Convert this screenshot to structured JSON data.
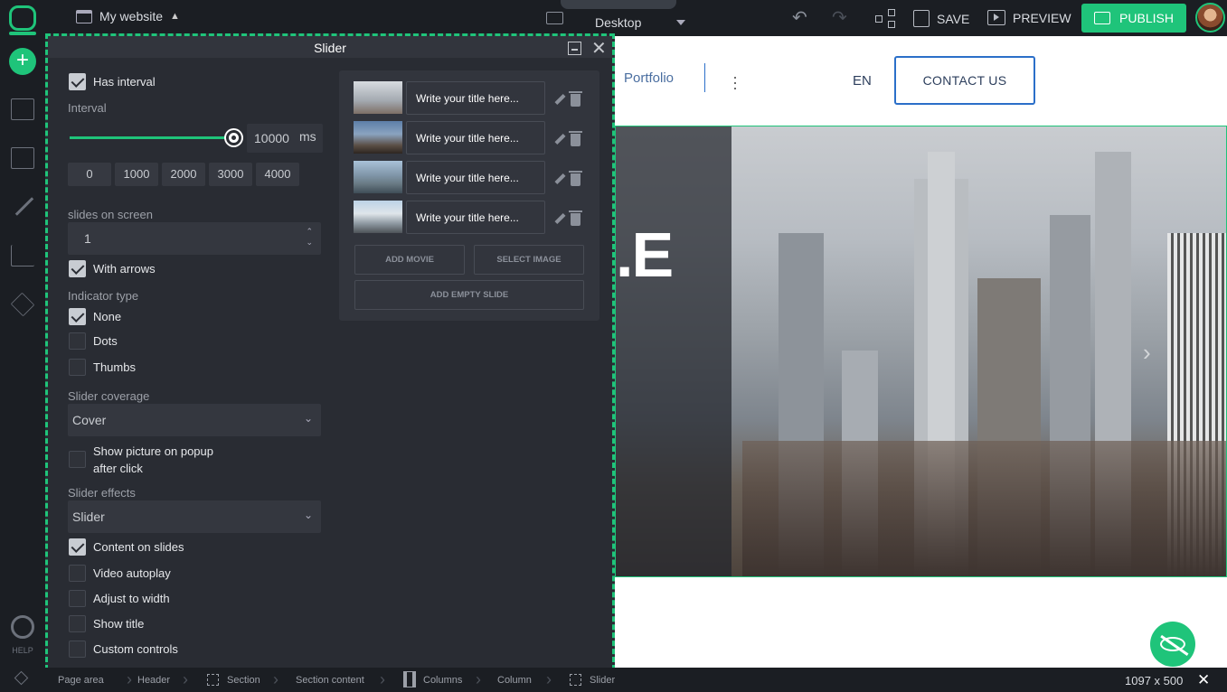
{
  "topbar": {
    "site_title": "My website",
    "device": "Desktop",
    "save_label": "SAVE",
    "preview_label": "PREVIEW",
    "publish_label": "PUBLISH"
  },
  "leftbar": {
    "help_label": "HELP"
  },
  "canvas": {
    "nav_portfolio": "Portfolio",
    "lang": "EN",
    "contact_label": "CONTACT US",
    "hero_text": ".E"
  },
  "panel": {
    "title": "Slider",
    "has_interval": "Has interval",
    "interval_label": "Interval",
    "interval_value": "10000",
    "interval_unit": "ms",
    "interval_level": 1.0,
    "presets": [
      "0",
      "1000",
      "2000",
      "3000",
      "4000"
    ],
    "slides_on_screen_label": "slides on screen",
    "slides_on_screen_value": "1",
    "with_arrows": "With arrows",
    "indicator_type_label": "Indicator type",
    "indicator_none": "None",
    "indicator_dots": "Dots",
    "indicator_thumbs": "Thumbs",
    "coverage_label": "Slider coverage",
    "coverage_value": "Cover",
    "popup_line1": "Show picture on popup",
    "popup_line2": "after click",
    "effects_label": "Slider effects",
    "effects_value": "Slider",
    "content_on_slides": "Content on slides",
    "video_autoplay": "Video autoplay",
    "adjust_to_width": "Adjust to width",
    "show_title": "Show title",
    "custom_controls": "Custom controls",
    "slides": [
      {
        "title_placeholder": "Write your title here..."
      },
      {
        "title_placeholder": "Write your title here..."
      },
      {
        "title_placeholder": "Write your title here..."
      },
      {
        "title_placeholder": "Write your title here..."
      }
    ],
    "add_movie": "ADD MOVIE",
    "select_image": "SELECT IMAGE",
    "add_empty_slide": "ADD EMPTY SLIDE"
  },
  "bottombar": {
    "crumbs": [
      "Page area",
      "Header",
      "Section",
      "Section content",
      "Columns",
      "Column",
      "Slider"
    ],
    "dimensions": "1097 x 500"
  },
  "colors": {
    "accent": "#1fc47a",
    "dark_bg": "#1b1e23",
    "panel_bg": "#292c33",
    "link_blue": "#2b6fc9"
  }
}
